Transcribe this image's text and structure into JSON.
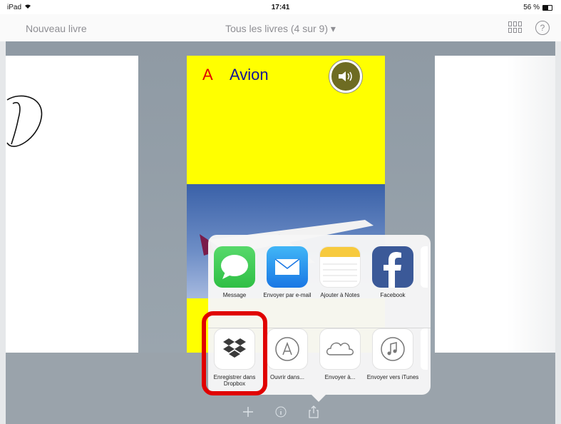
{
  "status_bar": {
    "device": "iPad",
    "time": "17:41",
    "battery": "56 %",
    "battery_level": 0.56
  },
  "nav_bar": {
    "left_button": "Nouveau livre",
    "title": "Tous les livres (4 sur 9) ▾"
  },
  "book": {
    "letter": "A",
    "word": "Avion"
  },
  "share_sheet": {
    "row1": [
      {
        "label": "Message",
        "icon": "message-icon"
      },
      {
        "label": "Envoyer par e-mail",
        "icon": "mail-icon"
      },
      {
        "label": "Ajouter à Notes",
        "icon": "notes-icon"
      },
      {
        "label": "Facebook",
        "icon": "facebook-icon"
      }
    ],
    "row2": [
      {
        "label": "Enregistrer dans Dropbox",
        "icon": "dropbox-icon"
      },
      {
        "label": "Ouvrir dans...",
        "icon": "app-store-icon"
      },
      {
        "label": "Envoyer à...",
        "icon": "cloud-icon"
      },
      {
        "label": "Envoyer vers iTunes",
        "icon": "music-note-icon"
      }
    ]
  },
  "colors": {
    "highlight": "#e00000",
    "book_yellow": "#ffff00",
    "letter_red": "#e00000",
    "word_blue": "#111199"
  }
}
